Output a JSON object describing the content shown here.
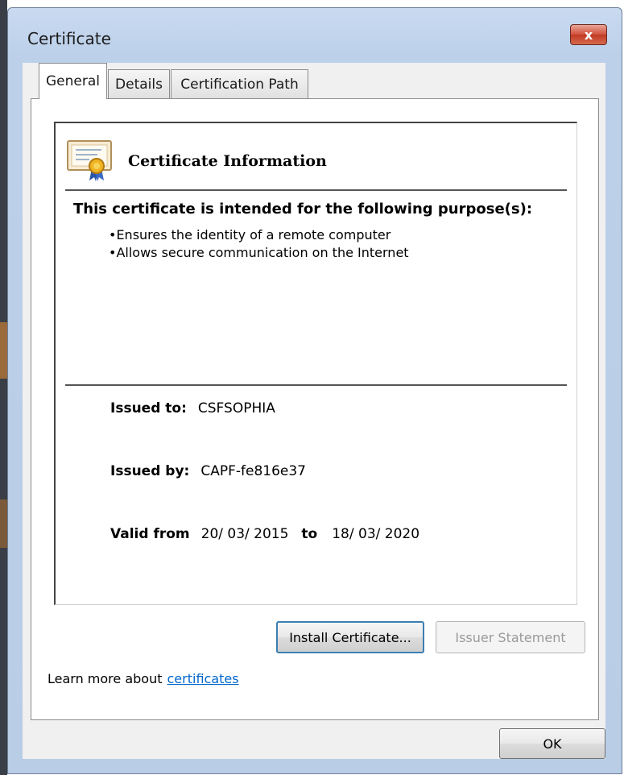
{
  "window": {
    "title": "Certificate",
    "close_label": "x"
  },
  "tabs": [
    {
      "label": "General",
      "active": true
    },
    {
      "label": "Details",
      "active": false
    },
    {
      "label": "Certification Path",
      "active": false
    }
  ],
  "general": {
    "info_title": "Certificate Information",
    "purpose_heading": "This certificate is intended for the following purpose(s):",
    "purposes": [
      "Ensures the identity of a remote computer",
      "Allows secure communication on the Internet"
    ],
    "issued_to_label": "Issued to:",
    "issued_to_value": "CSFSOPHIA",
    "issued_by_label": "Issued by:",
    "issued_by_value": "CAPF-fe816e37",
    "valid_from_label": "Valid from",
    "valid_from_value": "20/ 03/ 2015",
    "valid_to_label": "to",
    "valid_to_value": "18/ 03/ 2020",
    "install_button": "Install Certificate...",
    "issuer_statement_button": "Issuer Statement",
    "learn_more_text": "Learn more about",
    "learn_more_link": "certificates"
  },
  "footer": {
    "ok_button": "OK"
  },
  "icons": {
    "certificate": "certificate-icon",
    "close": "close-icon"
  }
}
